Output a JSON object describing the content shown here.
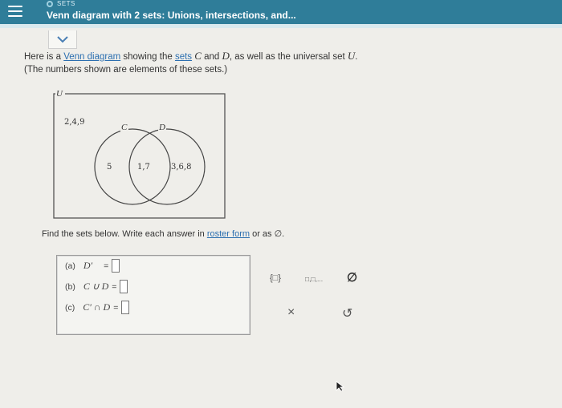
{
  "header": {
    "topic": "SETS",
    "title": "Venn diagram with 2 sets: Unions, intersections, and..."
  },
  "prompt": {
    "part1": "Here is a ",
    "link1": "Venn diagram",
    "part2": " showing the ",
    "link2": "sets",
    "var_c": "C",
    "part3": " and ",
    "var_d": "D",
    "part4": ", as well as the universal set ",
    "var_u": "U",
    "part5": ".",
    "line2": "(The numbers shown are elements of these sets.)"
  },
  "venn": {
    "universal_label": "U",
    "set_c_label": "C",
    "set_d_label": "D",
    "outside": "2,4,9",
    "c_only": "5",
    "intersection": "1,7",
    "d_only": "3,6,8"
  },
  "instruction": {
    "text1": "Find the sets below. Write each answer in ",
    "link": "roster form",
    "text2": " or as ∅."
  },
  "questions": [
    {
      "tag": "(a)",
      "expr": "D′",
      "eq": "="
    },
    {
      "tag": "(b)",
      "expr": "C ∪ D",
      "eq": "="
    },
    {
      "tag": "(c)",
      "expr": "C′ ∩ D",
      "eq": "="
    }
  ],
  "tools": {
    "braces": "{□}",
    "list": "□,□,...",
    "empty": "∅",
    "clear": "×",
    "undo": "↺"
  }
}
